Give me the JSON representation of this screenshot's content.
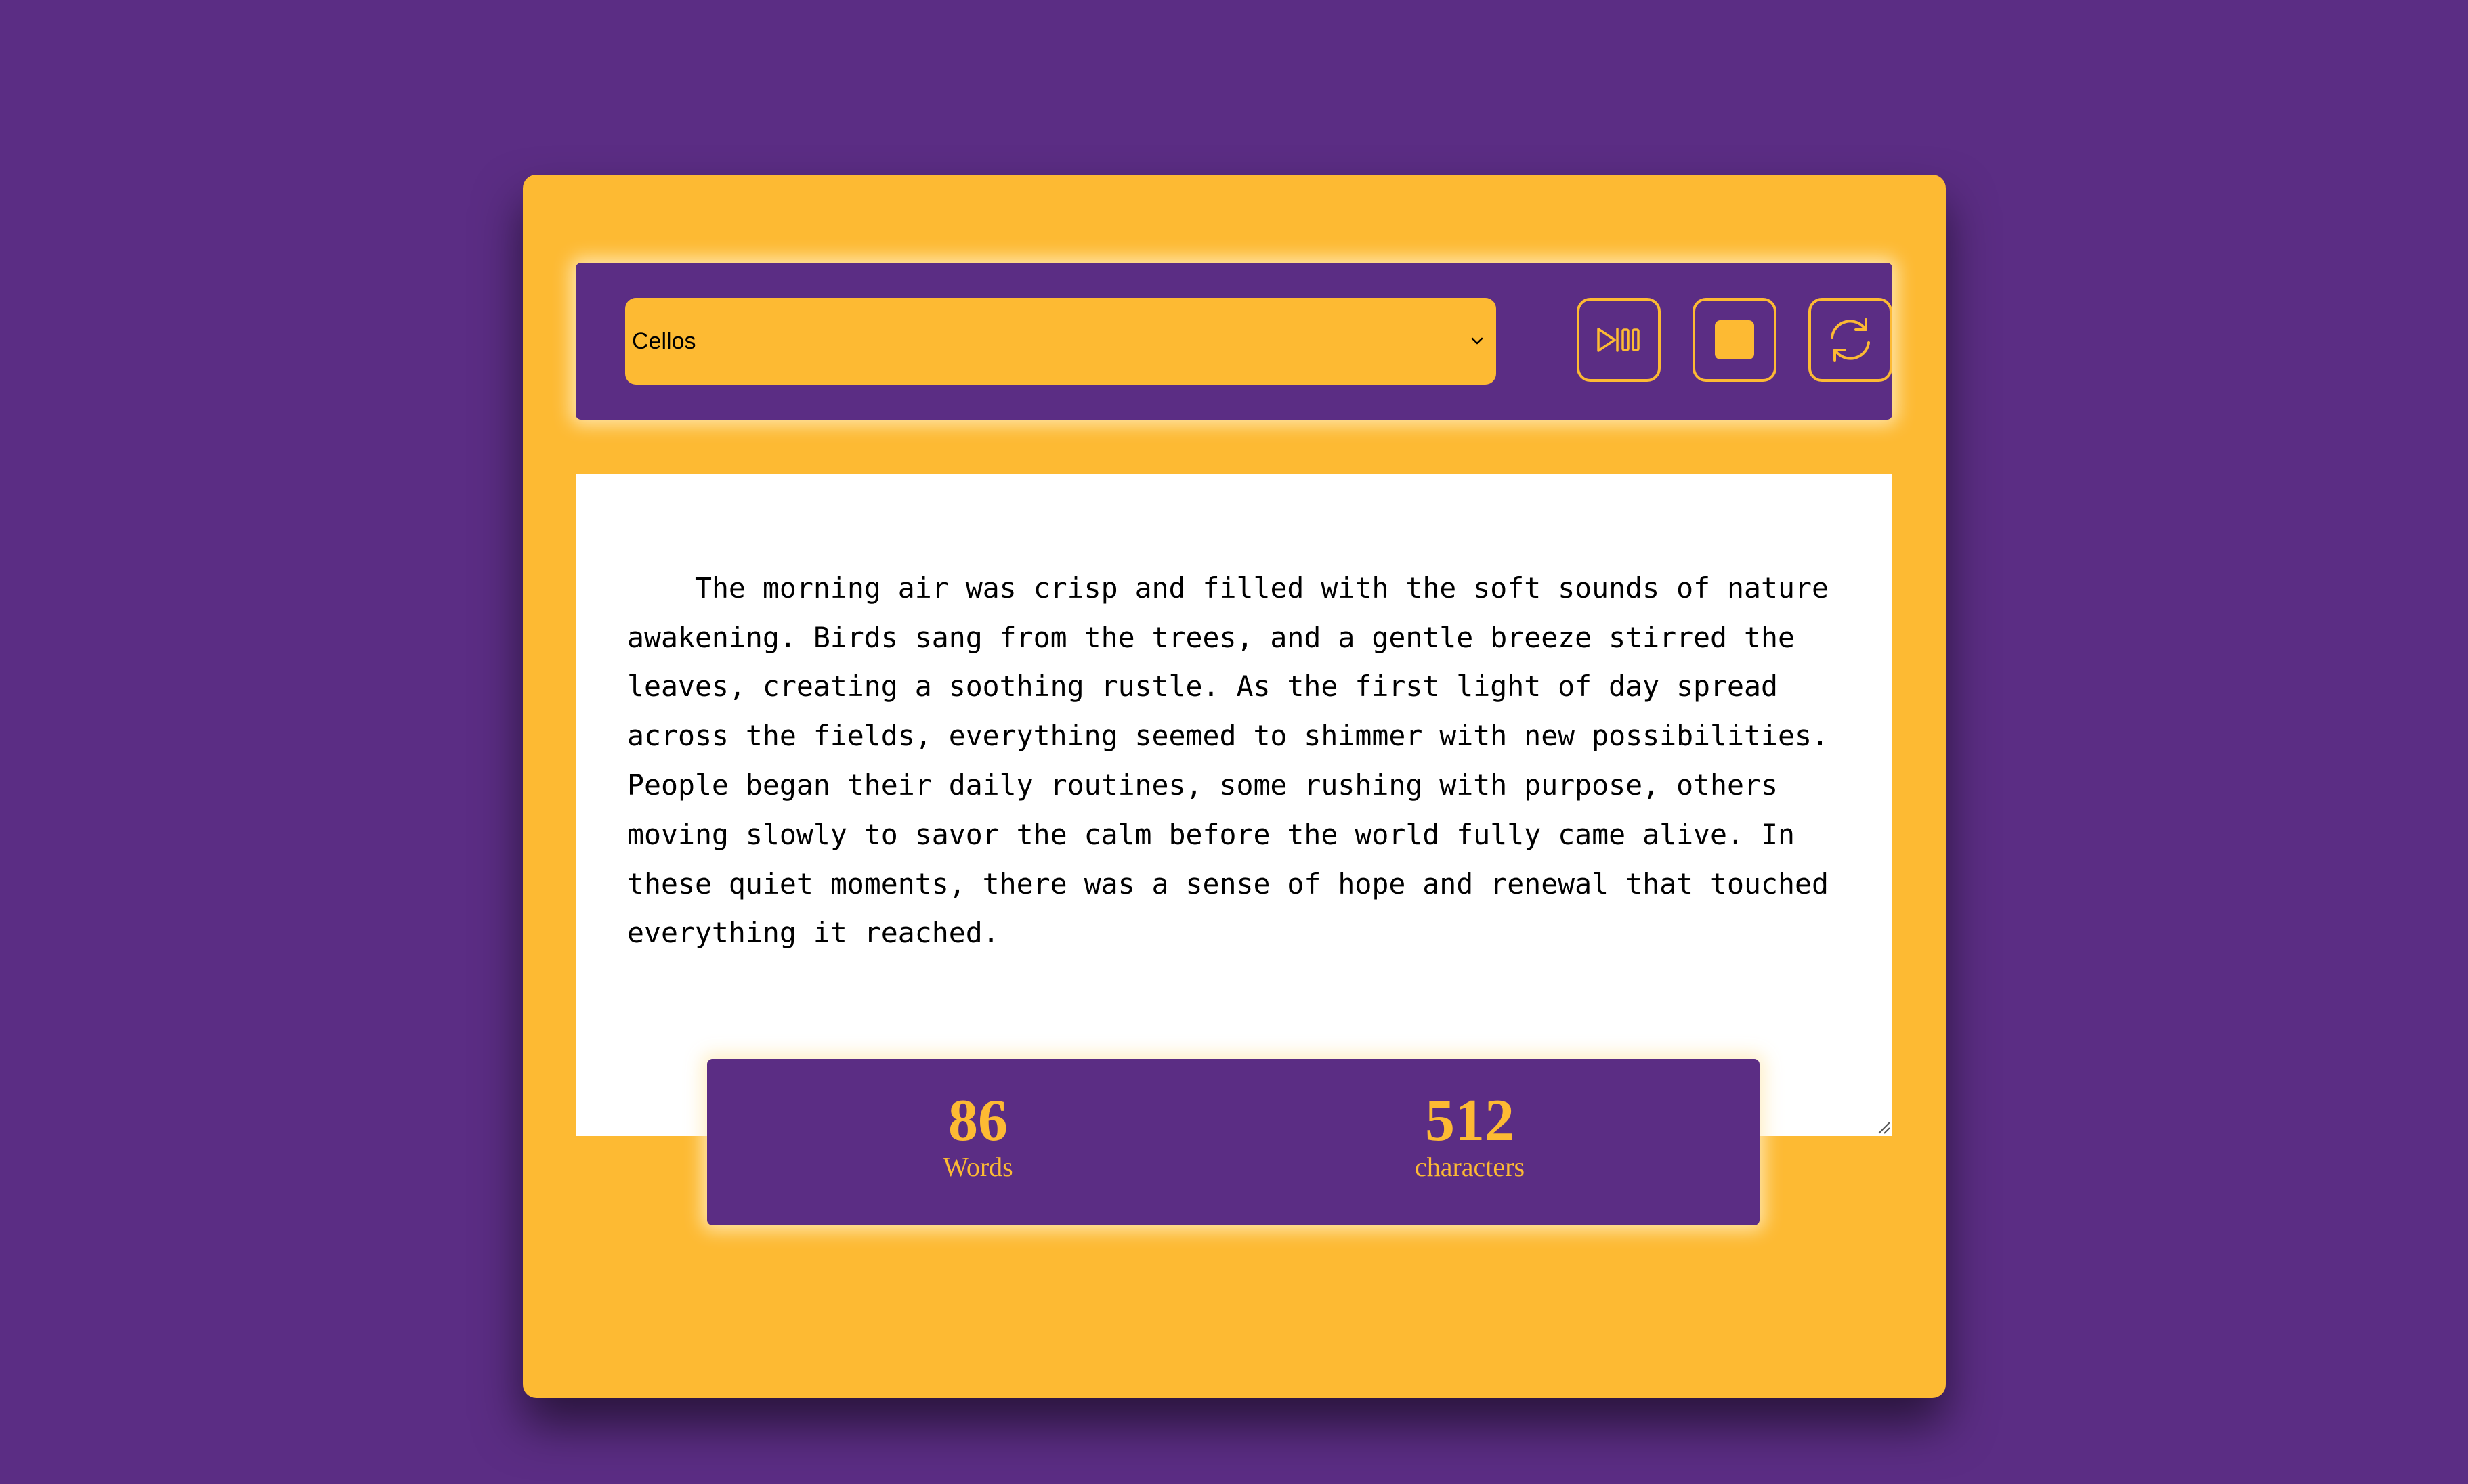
{
  "select": {
    "value": "Cellos"
  },
  "controls": {
    "play_pause_icon": "play-pause-icon",
    "stop_icon": "stop-icon",
    "reset_icon": "refresh-icon"
  },
  "editor": {
    "text": "The morning air was crisp and filled with the soft sounds of nature awakening. Birds sang from the trees, and a gentle breeze stirred the leaves, creating a soothing rustle. As the first light of day spread across the fields, everything seemed to shimmer with new possibilities. People began their daily routines, some rushing with purpose, others moving slowly to savor the calm before the world fully came alive. In these quiet moments, there was a sense of hope and renewal that touched everything it reached."
  },
  "stats": {
    "words_value": "86",
    "words_label": "Words",
    "chars_value": "512",
    "chars_label": "characters"
  },
  "colors": {
    "background": "#5b2d84",
    "accent": "#fdba33",
    "editor_bg": "#ffffff"
  }
}
